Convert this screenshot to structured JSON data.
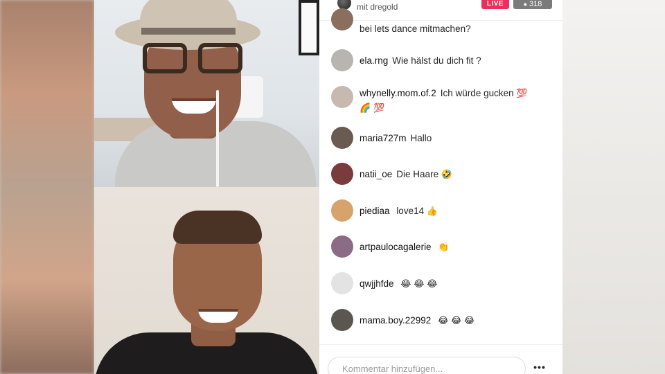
{
  "header": {
    "with_text": "mit dregold",
    "live_label": "LIVE",
    "viewer_count": "318"
  },
  "comments": [
    {
      "user": "",
      "message": "bei lets dance mitmachen?",
      "avatar": "#8a6e5e"
    },
    {
      "user": "ela.rng",
      "message": "Wie hälst du dich fit ?",
      "avatar": "#b8b4b0"
    },
    {
      "user": "whynelly.mom.of.2",
      "message": "Ich würde gucken",
      "emojis": [
        "💯",
        "🌈",
        "💯"
      ],
      "avatar": "#c7b9b0"
    },
    {
      "user": "maria727m",
      "message": "Hallo",
      "avatar": "#6b5a4f"
    },
    {
      "user": "natii_oe",
      "message": "Die Haare",
      "emojis": [
        "🤣"
      ],
      "avatar": "#7a3b3c"
    },
    {
      "user": "piediaa",
      "message": "love14",
      "emojis": [
        "👍"
      ],
      "avatar": "#d6a36a"
    },
    {
      "user": "artpaulocagalerie",
      "message": "",
      "emojis": [
        "👏"
      ],
      "avatar": "#8c6b86"
    },
    {
      "user": "qwjjhfde",
      "message": "",
      "emojis": [
        "😂",
        "😂",
        "😂"
      ],
      "avatar": "#e3e3e3"
    },
    {
      "user": "mama.boy.22992",
      "message": "",
      "emojis": [
        "😂",
        "😂",
        "😂"
      ],
      "avatar": "#5c5650"
    }
  ],
  "footer": {
    "comment_placeholder": "Kommentar hinzufügen...",
    "more_label": "•••"
  },
  "colors": {
    "live_badge": "#e8315a",
    "viewer_badge": "#7b7b7b"
  }
}
